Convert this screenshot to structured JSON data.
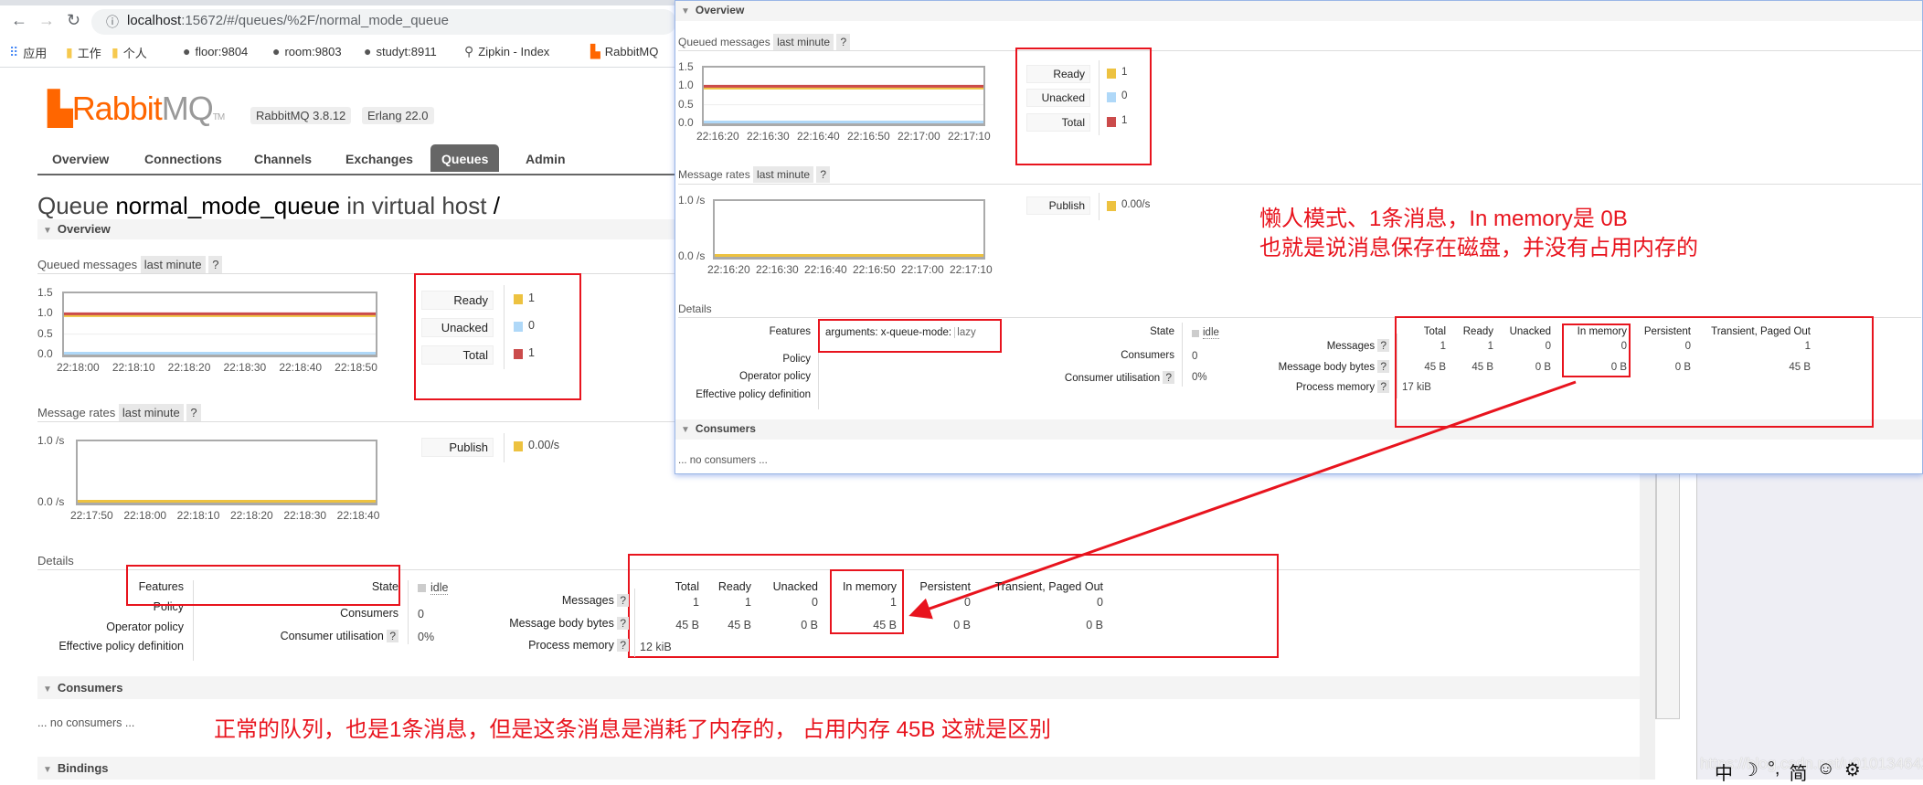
{
  "browser": {
    "url_host": "localhost",
    "url_rest": ":15672/#/queues/%2F/normal_mode_queue",
    "bookmarks": [
      {
        "icon": "apps-icon",
        "label": "应用"
      },
      {
        "icon": "folder-icon",
        "label": "工作"
      },
      {
        "icon": "folder-icon",
        "label": "个人"
      },
      {
        "icon": "globe-icon",
        "label": "floor:9804"
      },
      {
        "icon": "globe-icon",
        "label": "room:9803"
      },
      {
        "icon": "globe-icon",
        "label": "studyt:8911"
      },
      {
        "icon": "zipkin-icon",
        "label": "Zipkin - Index"
      },
      {
        "icon": "rabbitmq-icon",
        "label": "RabbitMQ"
      }
    ]
  },
  "app": {
    "logo": "RabbitMQ",
    "logo_tm": "TM",
    "version": "RabbitMQ 3.8.12",
    "erlang": "Erlang 22.0",
    "nav": [
      "Overview",
      "Connections",
      "Channels",
      "Exchanges",
      "Queues",
      "Admin"
    ],
    "active_nav": "Queues"
  },
  "page": {
    "title_prefix": "Queue",
    "queue_name": "normal_mode_queue",
    "title_mid": "in virtual host",
    "vhost": "/"
  },
  "labels": {
    "overview": "Overview",
    "queued_messages": "Queued messages",
    "last_minute": "last minute",
    "help": "?",
    "message_rates": "Message rates",
    "details": "Details",
    "features": "Features",
    "policy": "Policy",
    "operator_policy": "Operator policy",
    "effective_policy": "Effective policy definition",
    "state": "State",
    "consumers": "Consumers",
    "consumer_util": "Consumer utilisation",
    "messages": "Messages",
    "body_bytes": "Message body bytes",
    "process_memory": "Process memory",
    "consumers_section": "Consumers",
    "no_consumers": "... no consumers ...",
    "bindings": "Bindings",
    "ready": "Ready",
    "unacked": "Unacked",
    "total": "Total",
    "publish": "Publish",
    "table_cols": [
      "Total",
      "Ready",
      "Unacked",
      "In memory",
      "Persistent",
      "Transient, Paged Out"
    ]
  },
  "colors": {
    "ready": "#edc240",
    "unacked": "#afd8f8",
    "total": "#cb4b4b",
    "publish": "#edc240",
    "annotation": "#e8141e"
  },
  "normal": {
    "legend": {
      "ready": "1",
      "unacked": "0",
      "total": "1",
      "publish": "0.00/s"
    },
    "state": "idle",
    "consumers": "0",
    "consumer_util": "0%",
    "messages_row": [
      "1",
      "1",
      "0",
      "1",
      "0",
      "0"
    ],
    "bytes_row": [
      "45 B",
      "45 B",
      "0 B",
      "45 B",
      "0 B",
      "0 B"
    ],
    "process_memory": "12 kiB"
  },
  "lazy": {
    "legend": {
      "ready": "1",
      "unacked": "0",
      "total": "1",
      "publish": "0.00/s"
    },
    "features_key": "arguments:",
    "features_arg": "x-queue-mode:",
    "features_val": "lazy",
    "state": "idle",
    "consumers": "0",
    "consumer_util": "0%",
    "messages_row": [
      "1",
      "1",
      "0",
      "0",
      "0",
      "1"
    ],
    "bytes_row": [
      "45 B",
      "45 B",
      "0 B",
      "0 B",
      "0 B",
      "45 B"
    ],
    "process_memory": "17 kiB"
  },
  "annotations": {
    "lazy_line1": "懒人模式、1条消息，In memory是 0B",
    "lazy_line2": "也就是说消息保存在磁盘，并没有占用内存的",
    "normal": "正常的队列，也是1条消息，但是这条消息是消耗了内存的， 占用内存 45B 这就是区别"
  },
  "ime": {
    "items": [
      "中",
      "☽",
      "°,",
      "简",
      "☺",
      "⚙"
    ],
    "watermark": "https://blog.csdn.net/u010134642"
  },
  "chart_data": [
    {
      "id": "normal-queued",
      "type": "line",
      "ylim": [
        0,
        1.5
      ],
      "yticks": [
        "1.5",
        "1.0",
        "0.5",
        "0.0"
      ],
      "xticks": [
        "22:18:00",
        "22:18:10",
        "22:18:20",
        "22:18:30",
        "22:18:40",
        "22:18:50"
      ],
      "series": [
        {
          "name": "Ready",
          "color": "#edc240",
          "values": [
            1,
            1
          ]
        },
        {
          "name": "Unacked",
          "color": "#afd8f8",
          "values": [
            0,
            0
          ]
        },
        {
          "name": "Total",
          "color": "#cb4b4b",
          "values": [
            1,
            1
          ]
        }
      ]
    },
    {
      "id": "normal-rates",
      "type": "line",
      "ylim": [
        0,
        1.0
      ],
      "yticks": [
        "1.0 /s",
        "0.0 /s"
      ],
      "xticks": [
        "22:17:50",
        "22:18:00",
        "22:18:10",
        "22:18:20",
        "22:18:30",
        "22:18:40"
      ],
      "series": [
        {
          "name": "Publish",
          "color": "#edc240",
          "values": [
            0,
            0
          ]
        }
      ]
    },
    {
      "id": "lazy-queued",
      "type": "line",
      "ylim": [
        0,
        1.5
      ],
      "yticks": [
        "1.5",
        "1.0",
        "0.5",
        "0.0"
      ],
      "xticks": [
        "22:16:20",
        "22:16:30",
        "22:16:40",
        "22:16:50",
        "22:17:00",
        "22:17:10"
      ],
      "series": [
        {
          "name": "Ready",
          "color": "#edc240",
          "values": [
            1,
            1
          ]
        },
        {
          "name": "Unacked",
          "color": "#afd8f8",
          "values": [
            0,
            0
          ]
        },
        {
          "name": "Total",
          "color": "#cb4b4b",
          "values": [
            1,
            1
          ]
        }
      ]
    },
    {
      "id": "lazy-rates",
      "type": "line",
      "ylim": [
        0,
        1.0
      ],
      "yticks": [
        "1.0 /s",
        "0.0 /s"
      ],
      "xticks": [
        "22:16:20",
        "22:16:30",
        "22:16:40",
        "22:16:50",
        "22:17:00",
        "22:17:10"
      ],
      "series": [
        {
          "name": "Publish",
          "color": "#edc240",
          "values": [
            0,
            0
          ]
        }
      ]
    }
  ]
}
